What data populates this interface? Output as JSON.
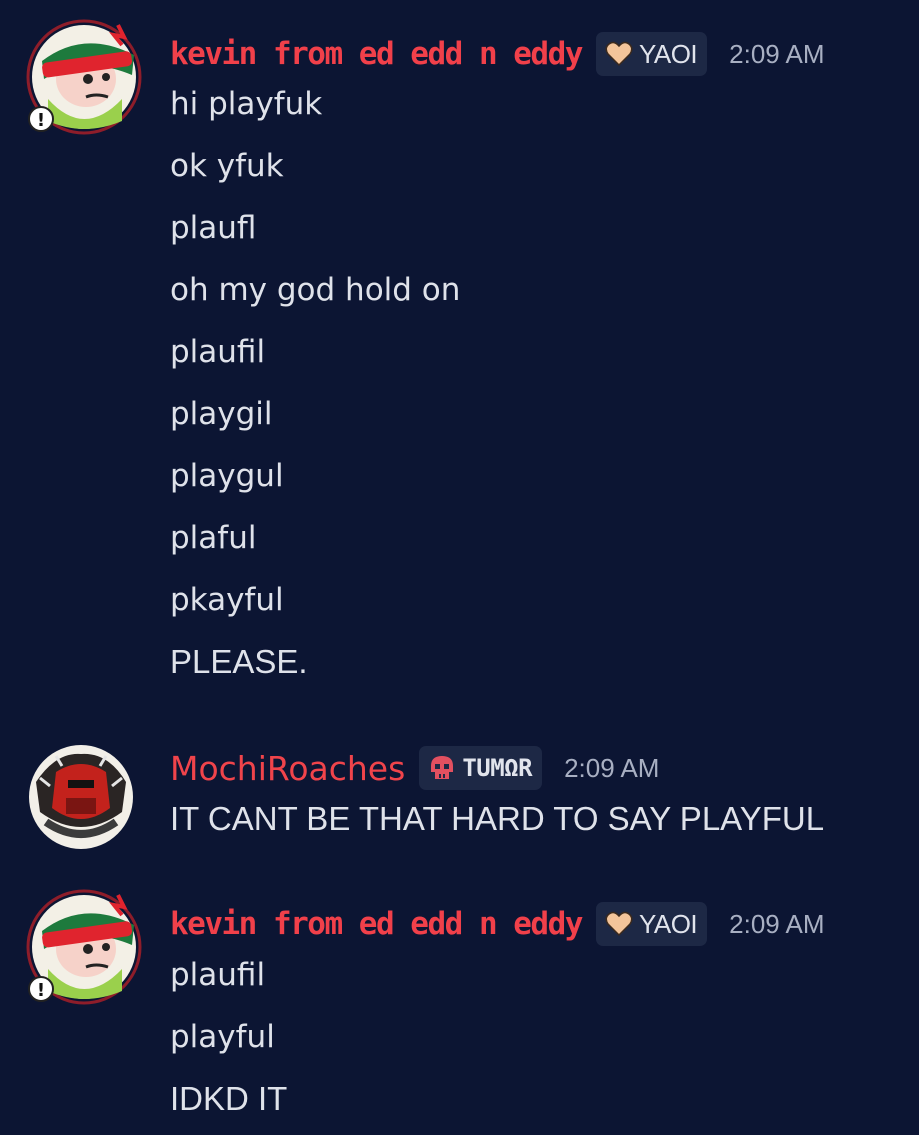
{
  "colors": {
    "background": "#0c1533",
    "username_kevin": "#f1404a",
    "username_mochi": "#f0444b",
    "tag_bg": "#1d2845",
    "timestamp": "#a8afc2",
    "text": "#dfe2ea"
  },
  "messages": [
    {
      "author": "kevin from ed edd n eddy",
      "tag": {
        "icon": "heart-icon",
        "label": "YAOI"
      },
      "time": "2:09 AM",
      "avatar_icon": "kevin-cartoon-avatar",
      "lines": [
        "hi playfuk",
        "ok yfuk",
        "plaufl",
        "oh my god hold on",
        "plaufil",
        "playgil",
        "playgul",
        "plaful",
        "pkayful",
        "PLEASE."
      ]
    },
    {
      "author": "MochiRoaches",
      "tag": {
        "icon": "skull-icon",
        "label": "TUMΩR"
      },
      "time": "2:09 AM",
      "avatar_icon": "red-figure-avatar",
      "lines": [
        "IT CANT BE THAT HARD TO SAY PLAYFUL"
      ]
    },
    {
      "author": "kevin from ed edd n eddy",
      "tag": {
        "icon": "heart-icon",
        "label": "YAOI"
      },
      "time": "2:09 AM",
      "avatar_icon": "kevin-cartoon-avatar",
      "lines": [
        "plaufil",
        "playful",
        "IDKD IT"
      ]
    }
  ]
}
